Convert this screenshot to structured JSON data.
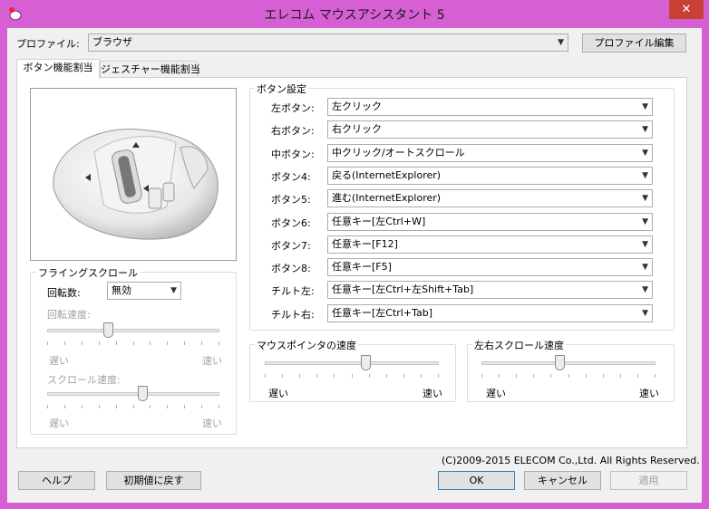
{
  "window": {
    "title": "エレコム マウスアシスタント 5",
    "close_glyph": "✕",
    "accent_color": "#d65fd3"
  },
  "profile": {
    "label": "プロファイル:",
    "value": "ブラウザ",
    "edit_button": "プロファイル編集"
  },
  "tabs": [
    {
      "label": "ボタン機能割当",
      "active": true
    },
    {
      "label": "ジェスチャー機能割当",
      "active": false
    }
  ],
  "button_settings": {
    "group_title": "ボタン設定",
    "rows": [
      {
        "label": "左ボタン:",
        "value": "左クリック"
      },
      {
        "label": "右ボタン:",
        "value": "右クリック"
      },
      {
        "label": "中ボタン:",
        "value": "中クリック/オートスクロール"
      },
      {
        "label": "ボタン4:",
        "value": "戻る(InternetExplorer)"
      },
      {
        "label": "ボタン5:",
        "value": "進む(InternetExplorer)"
      },
      {
        "label": "ボタン6:",
        "value": "任意キー[左Ctrl+W]"
      },
      {
        "label": "ボタン7:",
        "value": "任意キー[F12]"
      },
      {
        "label": "ボタン8:",
        "value": "任意キー[F5]"
      },
      {
        "label": "チルト左:",
        "value": "任意キー[左Ctrl+左Shift+Tab]"
      },
      {
        "label": "チルト右:",
        "value": "任意キー[左Ctrl+Tab]"
      }
    ]
  },
  "flying_scroll": {
    "group_title": "フライングスクロール",
    "rotation_label": "回転数:",
    "rotation_value": "無効",
    "rotation_speed_label": "回転速度:",
    "rotation_speed_level": 0.35,
    "slow": "遅い",
    "fast": "速い",
    "scroll_speed_label": "スクロール速度:",
    "scroll_speed_level": 0.55
  },
  "pointer_speed": {
    "group_title": "マウスポインタの速度",
    "level": 0.58,
    "slow": "遅い",
    "fast": "速い"
  },
  "hscroll_speed": {
    "group_title": "左右スクロール速度",
    "level": 0.45,
    "slow": "遅い",
    "fast": "速い"
  },
  "copyright": "(C)2009-2015 ELECOM Co.,Ltd. All Rights Reserved.",
  "footer": {
    "help": "ヘルプ",
    "reset": "初期値に戻す",
    "ok": "OK",
    "cancel": "キャンセル",
    "apply": "適用"
  }
}
